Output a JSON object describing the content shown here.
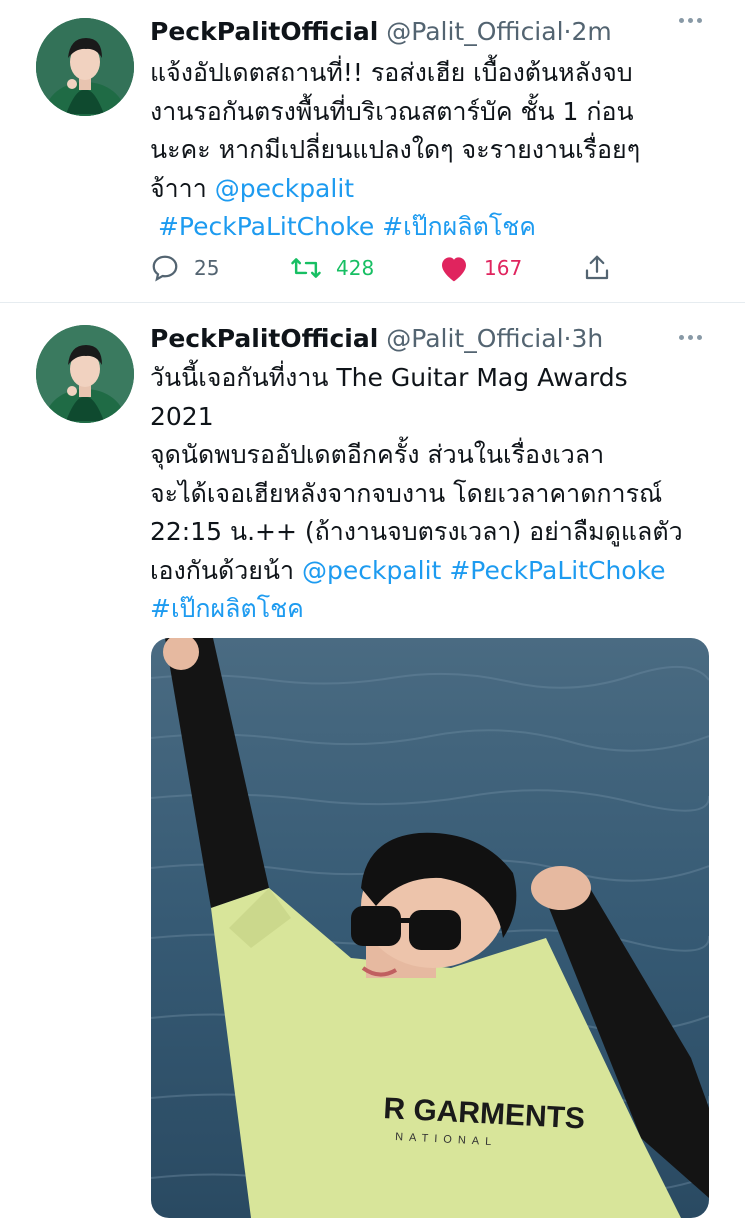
{
  "tweets": [
    {
      "name": "PeckPalitOfficial",
      "handle": "@Palit_Official",
      "dot": "·",
      "time": "2m",
      "lines": [
        "แจ้งอัปเดตสถานที่!! รอส่งเฮีย เบื้องต้นหลังจบ",
        "งานรอกันตรงพื้นที่บริเวณสตาร์บัค ชั้น 1 ก่อน",
        "นะคะ หากมีเปลี่ยนแปลงใดๆ จะรายงานเรื่อยๆ",
        "จ้าาา"
      ],
      "mention": "@peckpalit",
      "hashtag1": "#PeckPaLitChoke",
      "hashtag2": "#เป๊กผลิตโชค",
      "replies": "25",
      "retweets": "428",
      "likes": "167"
    },
    {
      "name": "PeckPalitOfficial",
      "handle": "@Palit_Official",
      "dot": "·",
      "time": "3h",
      "lines": [
        "วันนี้เจอกันที่งาน The Guitar Mag Awards",
        "2021",
        "จุดนัดพบรออัปเดตอีกครั้ง ส่วนในเรื่องเวลา",
        "จะได้เจอเฮียหลังจากจบงาน โดยเวลาคาดการณ์",
        "22:15 น.++ (ถ้างานจบตรงเวลา) อย่าลืมดูแลตัว",
        "เองกันด้วยน้า"
      ],
      "mention": "@peckpalit",
      "hashtag1": "#PeckPaLitChoke",
      "hashtag2": "#เป๊กผลิตโชค",
      "media_print": "R GARMENTS",
      "media_print_sub": "NATIONAL"
    }
  ],
  "colors": {
    "link": "#1d9bf0",
    "retweet": "#17bf63",
    "like": "#e0245e",
    "muted": "#536471"
  },
  "icons": [
    "more-icon",
    "reply-icon",
    "retweet-icon",
    "heart-icon",
    "share-icon"
  ]
}
